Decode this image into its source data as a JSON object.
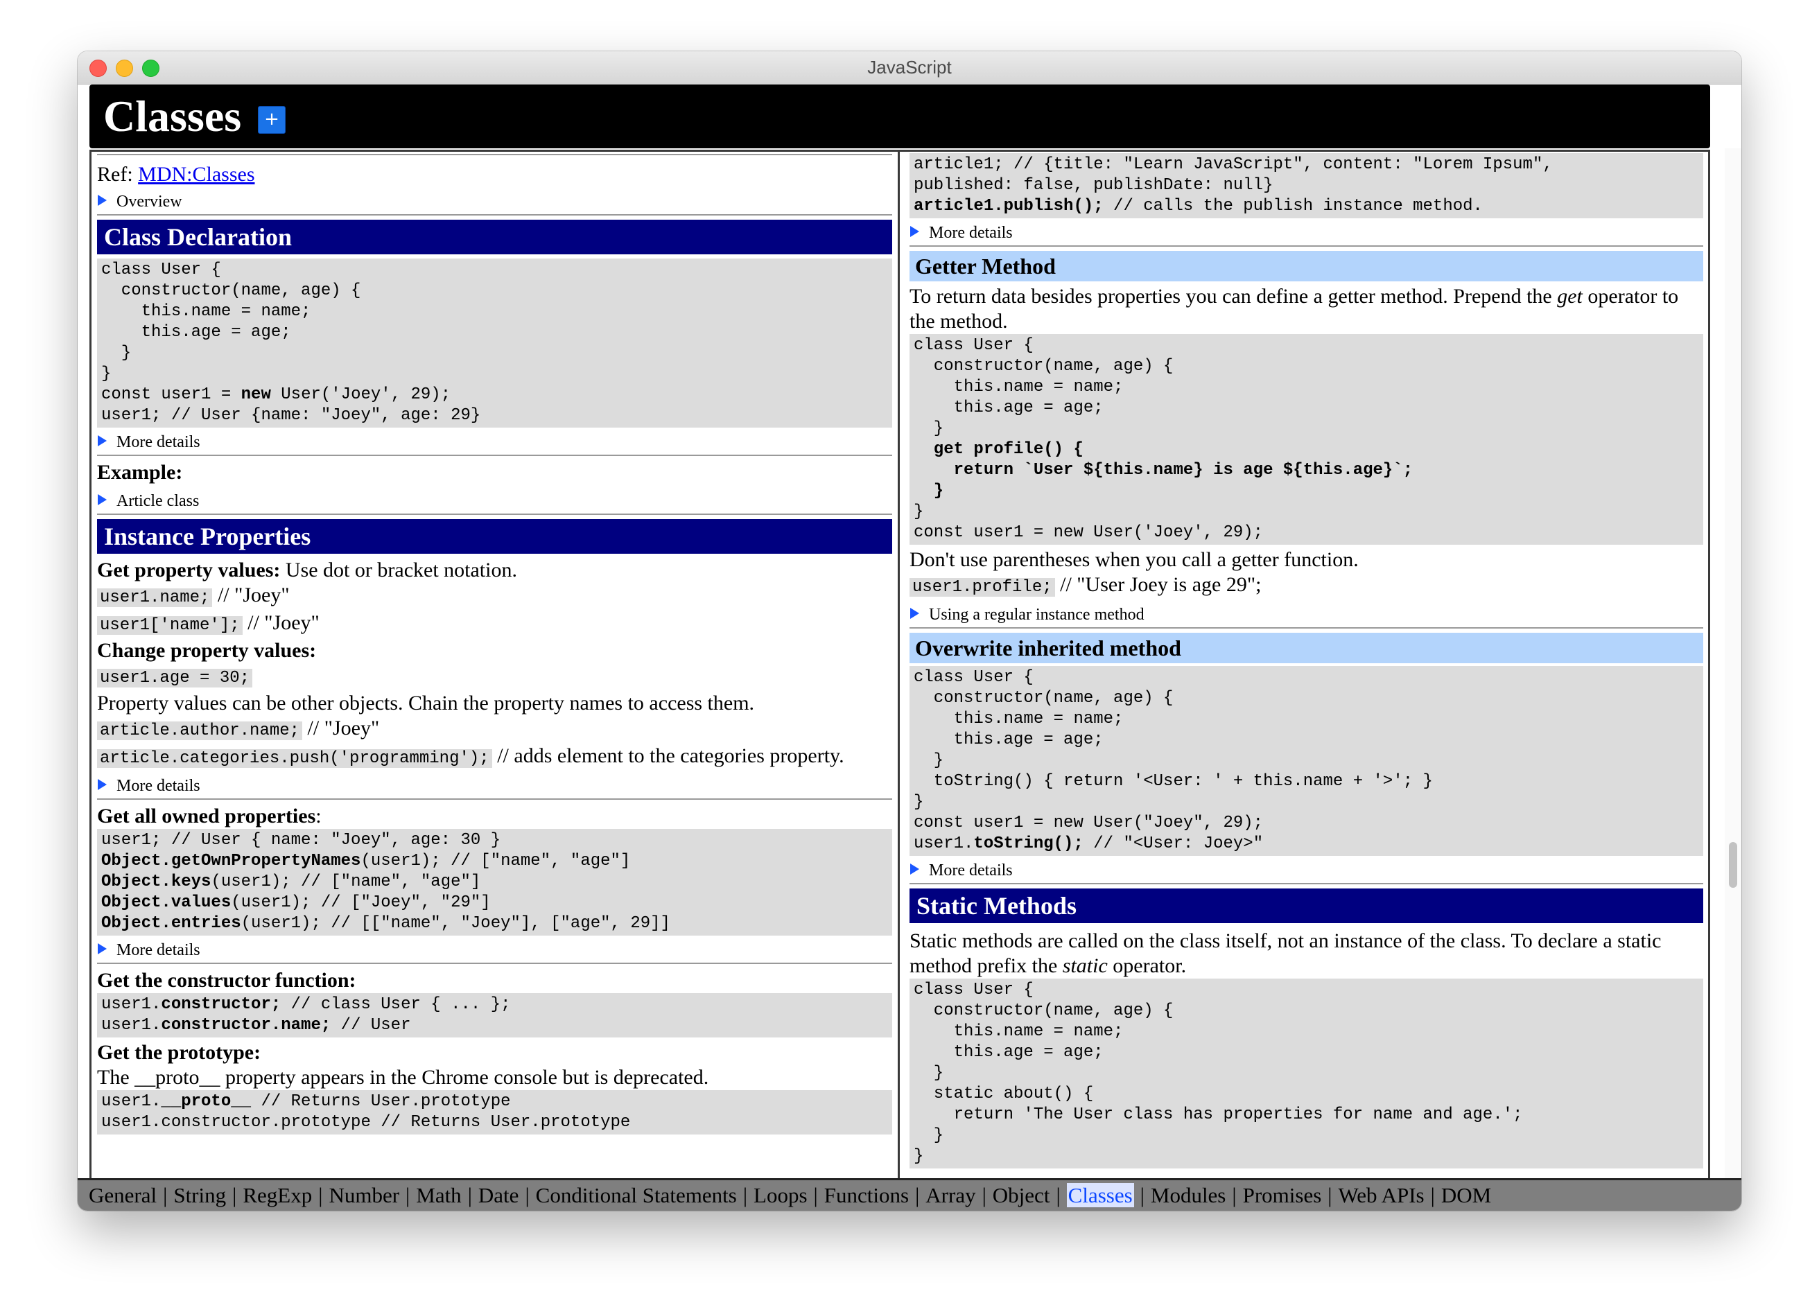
{
  "window": {
    "title": "JavaScript"
  },
  "page": {
    "title": "Classes",
    "add_button": "+"
  },
  "left": {
    "ref_label": "Ref:",
    "ref_link": "MDN:Classes",
    "overview": "Overview",
    "class_declaration": {
      "heading": "Class Declaration",
      "code": [
        "class User {",
        "  constructor(name, age) {",
        "    this.name = name;",
        "    this.age = age;",
        "  }",
        "}"
      ],
      "code_new_prefix": "const user1 = ",
      "code_new_bold": "new",
      "code_new_suffix": " User('Joey', 29);",
      "code_last": "user1; // User {name: \"Joey\", age: 29}",
      "more_details": "More details",
      "example_label": "Example:",
      "article_class": "Article class"
    },
    "instance_properties": {
      "heading": "Instance Properties",
      "get_label": "Get property values:",
      "get_text": " Use dot or bracket notation.",
      "dot_code": "user1.name;",
      "dot_comment": " // \"Joey\"",
      "bracket_code": "user1['name'];",
      "bracket_comment": " // \"Joey\"",
      "change_label": "Change property values:",
      "change_code": "user1.age = 30;",
      "chain_text": "Property values can be other objects. Chain the property names to access them.",
      "author_code": "article.author.name;",
      "author_comment": " // \"Joey\"",
      "push_code": "article.categories.push('programming');",
      "push_comment": " // adds element to the categories property.",
      "more_details": "More details"
    },
    "owned_properties": {
      "label": "Get all owned properties",
      "label_suffix": ":",
      "line1": "user1; // User { name: \"Joey\", age: 30 }",
      "line2_bold": "Object.getOwnPropertyNames",
      "line2_rest": "(user1); // [\"name\", \"age\"]",
      "line3_bold": "Object.keys",
      "line3_rest": "(user1); // [\"name\", \"age\"]",
      "line4_bold": "Object.values",
      "line4_rest": "(user1); // [\"Joey\", \"29\"]",
      "line5_bold": "Object.entries",
      "line5_rest": "(user1); // [[\"name\", \"Joey\"], [\"age\", 29]]",
      "more_details": "More details"
    },
    "constructor_fn": {
      "label": "Get the constructor function:",
      "line1_a": "user1.",
      "line1_b": "constructor;",
      "line1_c": " // class User { ... };",
      "line2_a": "user1.",
      "line2_b": "constructor.name;",
      "line2_c": " // User"
    },
    "prototype": {
      "label": "Get the prototype:",
      "text": "The __proto__ property appears in the Chrome console but is deprecated.",
      "line1_a": "user1.",
      "line1_b": "__proto__",
      "line1_c": " // Returns User.prototype",
      "line2": "user1.constructor.prototype // Returns User.prototype"
    }
  },
  "right": {
    "top_code": {
      "line1": "article1; // {title: \"Learn JavaScript\", content: \"Lorem Ipsum\",",
      "line2": "published: false, publishDate: null}",
      "line3_bold": "article1.publish();",
      "line3_rest": " // calls the publish instance method."
    },
    "more_details_1": "More details",
    "getter": {
      "heading": "Getter Method",
      "text_a": "To return data besides properties you can define a getter method. Prepend the ",
      "text_em": "get",
      "text_b": " operator to the method.",
      "code": [
        "class User {",
        "  constructor(name, age) {",
        "    this.name = name;",
        "    this.age = age;",
        "  }"
      ],
      "bold1": "  get profile() {",
      "bold2": "    return `User ${this.name} is age ${this.age}`;",
      "bold3": "  }",
      "code_end": "}",
      "code_last": "const user1 = new User('Joey', 29);",
      "paren_text": "Don't use parentheses when you call a getter function.",
      "profile_code": "user1.profile;",
      "profile_comment": " // \"User Joey is age 29\";",
      "regular_method": "Using a regular instance method"
    },
    "overwrite": {
      "heading": "Overwrite inherited method",
      "code": [
        "class User {",
        "  constructor(name, age) {",
        "    this.name = name;",
        "    this.age = age;",
        "  }",
        "  toString() { return '<User: ' + this.name + '>'; }",
        "}",
        "const user1 = new User(\"Joey\", 29);"
      ],
      "last_a": "user1.",
      "last_b": "toString();",
      "last_c": " // \"<User: Joey>\"",
      "more_details": "More details"
    },
    "static": {
      "heading": "Static Methods",
      "text_a": "Static methods are called on the class itself, not an instance of the class. To declare a static method prefix the ",
      "text_em": "static",
      "text_b": " operator.",
      "code": [
        "class User {",
        "  constructor(name, age) {",
        "    this.name = name;",
        "    this.age = age;",
        "  }",
        "  static about() {",
        "    return 'The User class has properties for name and age.';",
        "  }",
        "}"
      ]
    }
  },
  "nav": {
    "items": [
      "General",
      "String",
      "RegExp",
      "Number",
      "Math",
      "Date",
      "Conditional Statements",
      "Loops",
      "Functions",
      "Array",
      "Object",
      "Classes",
      "Modules",
      "Promises",
      "Web APIs",
      "DOM"
    ],
    "active": "Classes",
    "separator": "|"
  }
}
